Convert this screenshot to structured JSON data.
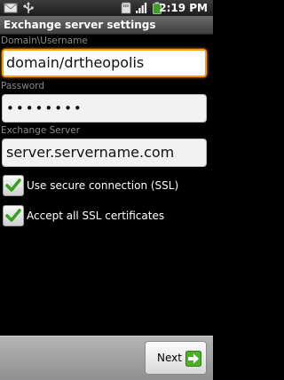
{
  "status_bar": {
    "time": "2:19 PM",
    "icons": [
      "email-icon",
      "usb-icon",
      "sd-card-icon",
      "signal-icon",
      "battery-icon"
    ]
  },
  "title_bar": {
    "title": "Exchange server settings"
  },
  "form": {
    "username_label": "Domain\\Username",
    "username_value": "domain/drtheopolis",
    "password_label": "Password",
    "password_value": "••••••••",
    "server_label": "Exchange Server",
    "server_value": "server.servername.com",
    "ssl_label": "Use secure connection (SSL)",
    "ssl_checked": true,
    "accept_certs_label": "Accept all SSL certificates",
    "accept_certs_checked": true
  },
  "footer": {
    "next_label": "Next"
  },
  "colors": {
    "focus": "#ff9a00",
    "check": "#3aa020",
    "next_arrow": "#4caf28"
  }
}
